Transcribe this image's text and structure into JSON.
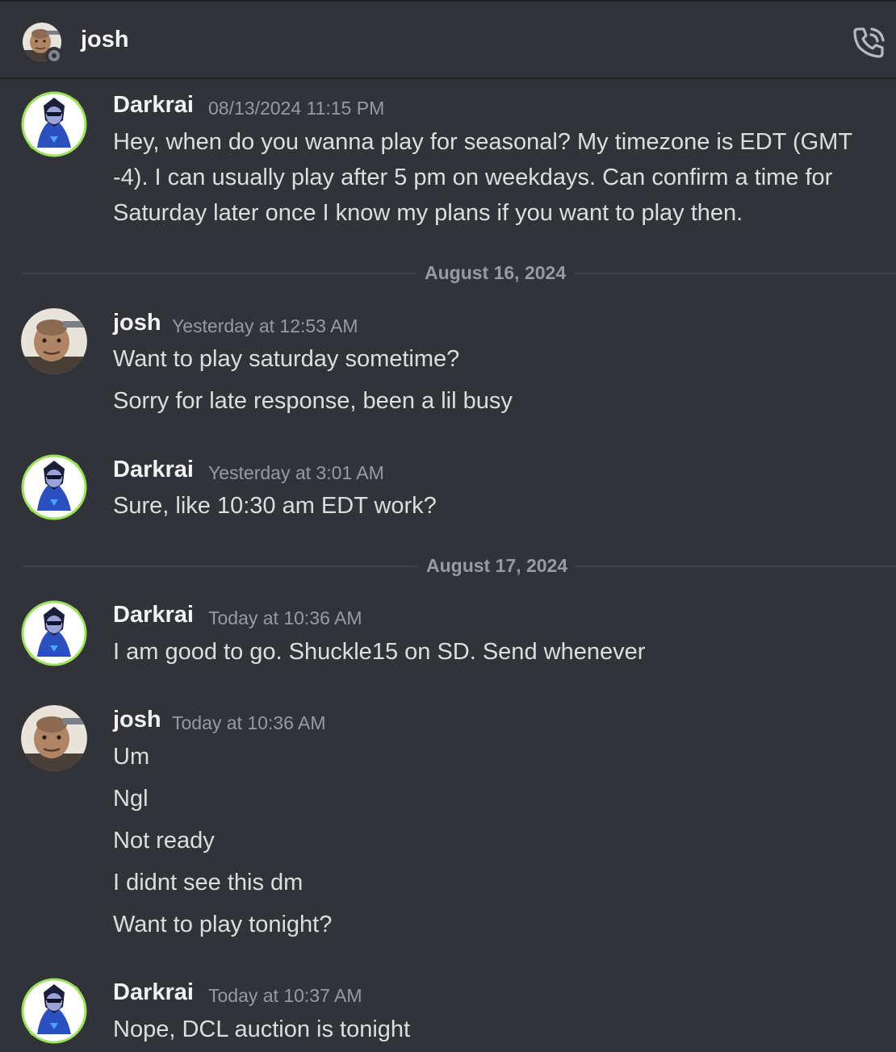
{
  "header": {
    "title": "josh",
    "status": "offline",
    "call_icon": "phone-call-icon"
  },
  "messages": [
    {
      "author": "Darkrai",
      "timestamp": "08/13/2024 11:15 PM",
      "lines": [
        "Hey, when do you wanna play for seasonal? My timezone is EDT (GMT",
        "-4). I can usually play after 5 pm on weekdays. Can confirm a time for",
        "Saturday later once I know my plans if you want to play then."
      ]
    },
    {
      "author": "josh",
      "timestamp": "Yesterday at 12:53 AM",
      "lines": [
        "Want to play saturday sometime?",
        "Sorry for late response, been a lil busy"
      ]
    },
    {
      "author": "Darkrai",
      "timestamp": "Yesterday at 3:01 AM",
      "lines": [
        "Sure, like 10:30 am EDT work?"
      ]
    },
    {
      "author": "Darkrai",
      "timestamp": "Today at 10:36 AM",
      "lines": [
        "I am good to go. Shuckle15 on SD. Send whenever"
      ]
    },
    {
      "author": "josh",
      "timestamp": "Today at 10:36 AM",
      "lines": [
        "Um",
        "Ngl",
        "Not ready",
        "I didnt see this dm",
        "Want to play tonight?"
      ]
    },
    {
      "author": "Darkrai",
      "timestamp": "Today at 10:37 AM",
      "lines": [
        "Nope, DCL auction is tonight"
      ]
    }
  ],
  "dividers": [
    "August 16, 2024",
    "August 17, 2024"
  ],
  "colors": {
    "background": "#313338",
    "author": "#f2f3f5",
    "text": "#dbdee1",
    "muted": "#949ba4",
    "divider": "#3f4147",
    "darkrai_ring": "#9be25a"
  }
}
